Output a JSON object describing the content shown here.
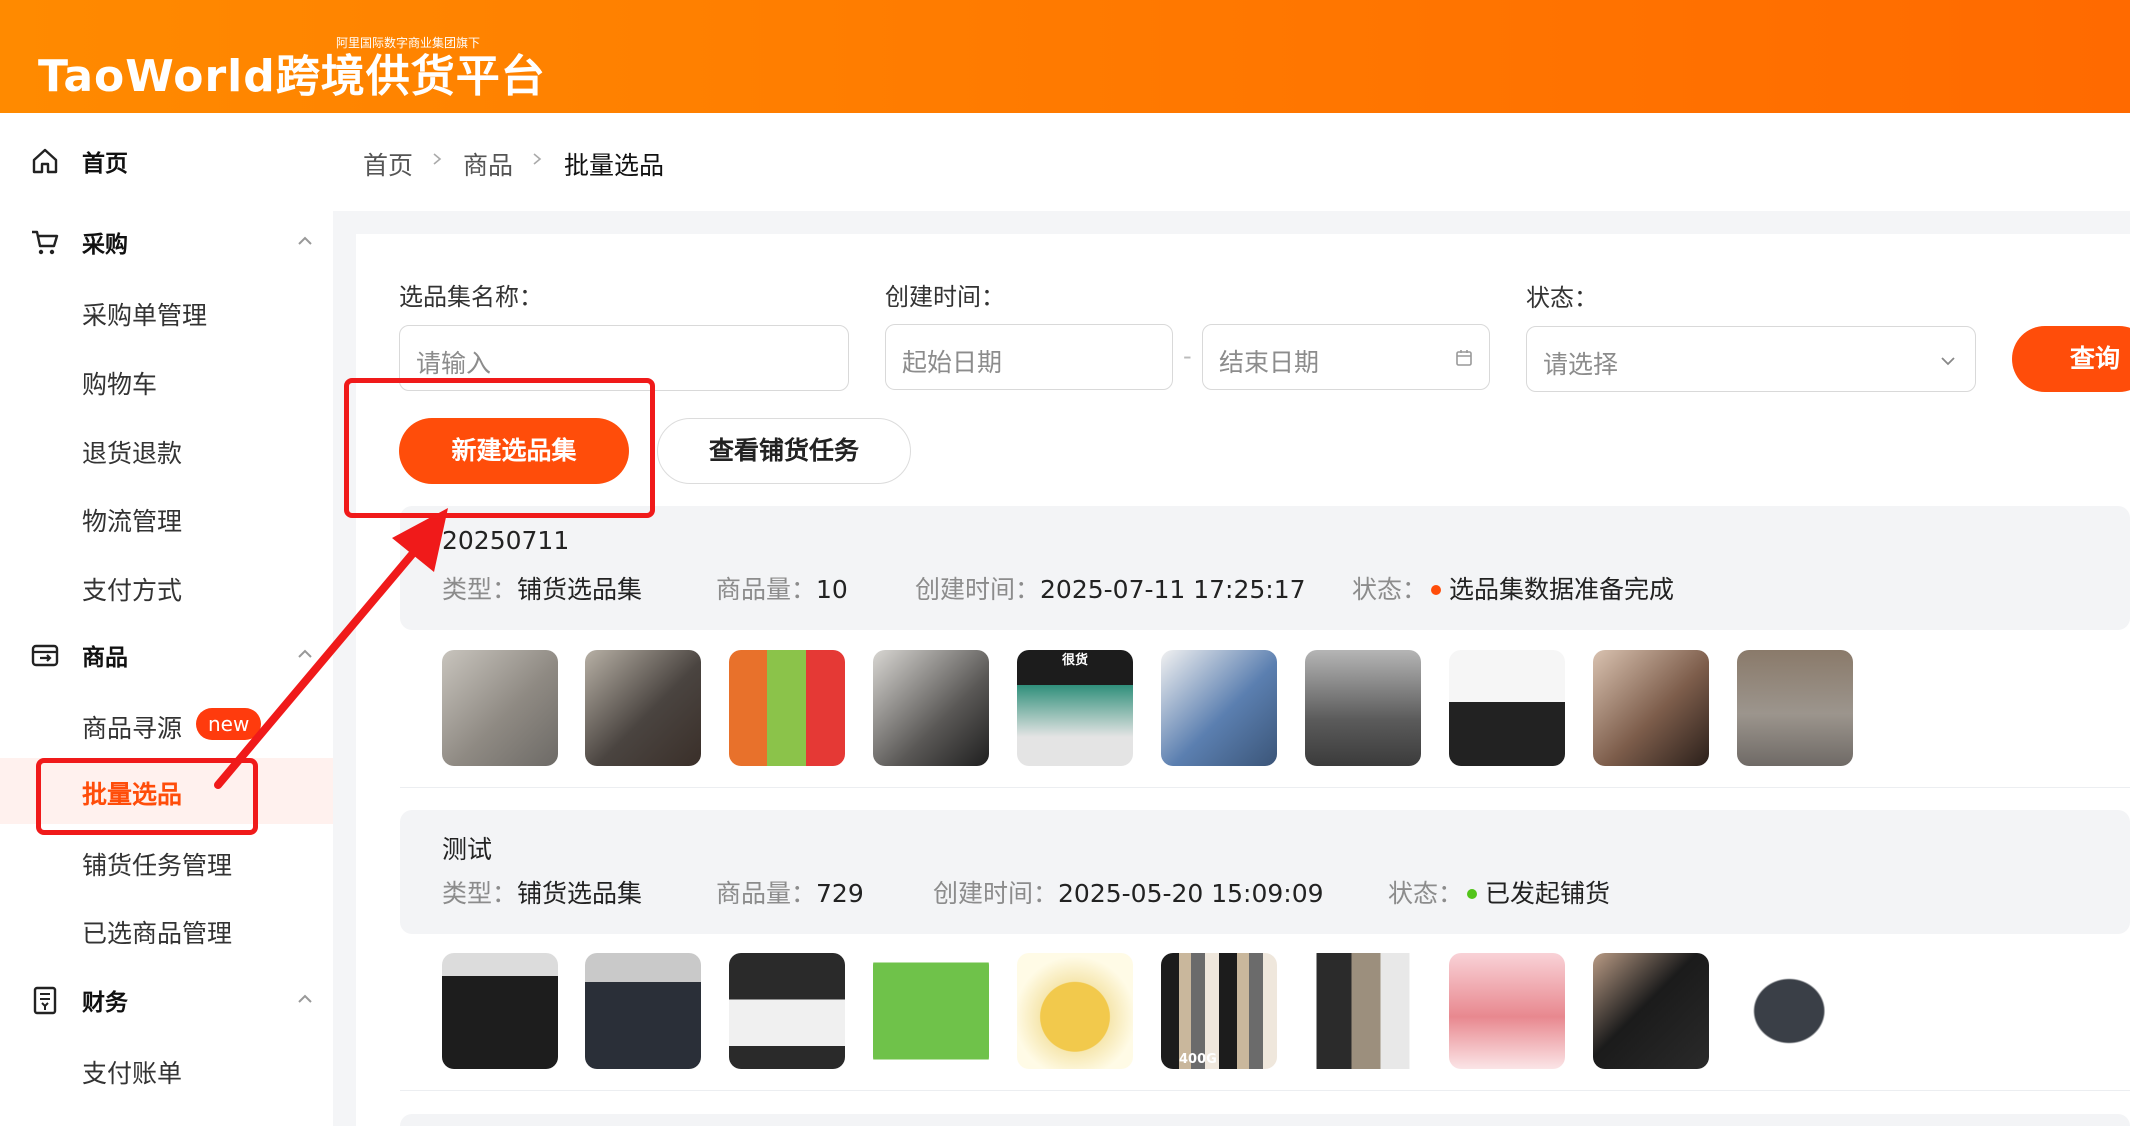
{
  "header": {
    "logo_text": "TaoWorld跨境供货平台",
    "logo_tagline": "阿里国际数字商业集团旗下"
  },
  "sidebar": {
    "groups": [
      {
        "label": "首页",
        "icon": "home-icon"
      },
      {
        "label": "采购",
        "icon": "cart-icon",
        "items": [
          "采购单管理",
          "购物车",
          "退货退款",
          "物流管理",
          "支付方式"
        ]
      },
      {
        "label": "商品",
        "icon": "product-icon",
        "items": [
          "商品寻源",
          "批量选品",
          "铺货任务管理",
          "已选商品管理"
        ],
        "badge": "new",
        "active_item": "批量选品"
      },
      {
        "label": "财务",
        "icon": "finance-icon",
        "items": [
          "支付账单"
        ]
      }
    ]
  },
  "breadcrumb": [
    "首页",
    "商品",
    "批量选品"
  ],
  "filters": {
    "name_label": "选品集名称：",
    "name_placeholder": "请输入",
    "date_label": "创建时间：",
    "start_placeholder": "起始日期",
    "end_placeholder": "结束日期",
    "date_separator": "-",
    "status_label": "状态：",
    "status_placeholder": "请选择",
    "query_button": "查询"
  },
  "actions": {
    "new_collection": "新建选品集",
    "view_tasks": "查看铺货任务"
  },
  "collections": [
    {
      "name": "20250711",
      "type_label": "类型：",
      "type": "铺货选品集",
      "count_label": "商品量：",
      "count": "10",
      "created_label": "创建时间：",
      "created": "2025-07-11 17:25:17",
      "status_label": "状态：",
      "status": "选品集数据准备完成",
      "status_color": "#ff4d0a",
      "thumbnails": [
        "clog-shoes",
        "ballet-flats",
        "colorful-slippers-grid",
        "black-sandals",
        "sneakers-promo",
        "denim-shoes",
        "gray-dress",
        "platform-boots",
        "black-heels",
        "gray-clogs"
      ],
      "thumbnail_captions": [
        "",
        "",
        "",
        "",
        "很货",
        "",
        "",
        "",
        "",
        ""
      ]
    },
    {
      "name": "测试",
      "type_label": "类型：",
      "type": "铺货选品集",
      "count_label": "商品量：",
      "count": "729",
      "created_label": "创建时间：",
      "created": "2025-05-20 15:09:09",
      "status_label": "状态：",
      "status": "已发起铺货",
      "status_color": "#52c41a",
      "thumbnails": [
        "black-tshirt-man",
        "jeans-man",
        "white-product",
        "cartoon-card",
        "cartoon-cushion",
        "tshirt-rack",
        "hoodies",
        "gift-box",
        "black-coat",
        "gray-tshirt"
      ],
      "thumbnail_captions": [
        "",
        "",
        "",
        "",
        "",
        "400G",
        "",
        "",
        "",
        ""
      ]
    }
  ],
  "annotation": {
    "color": "#f01a1a"
  }
}
